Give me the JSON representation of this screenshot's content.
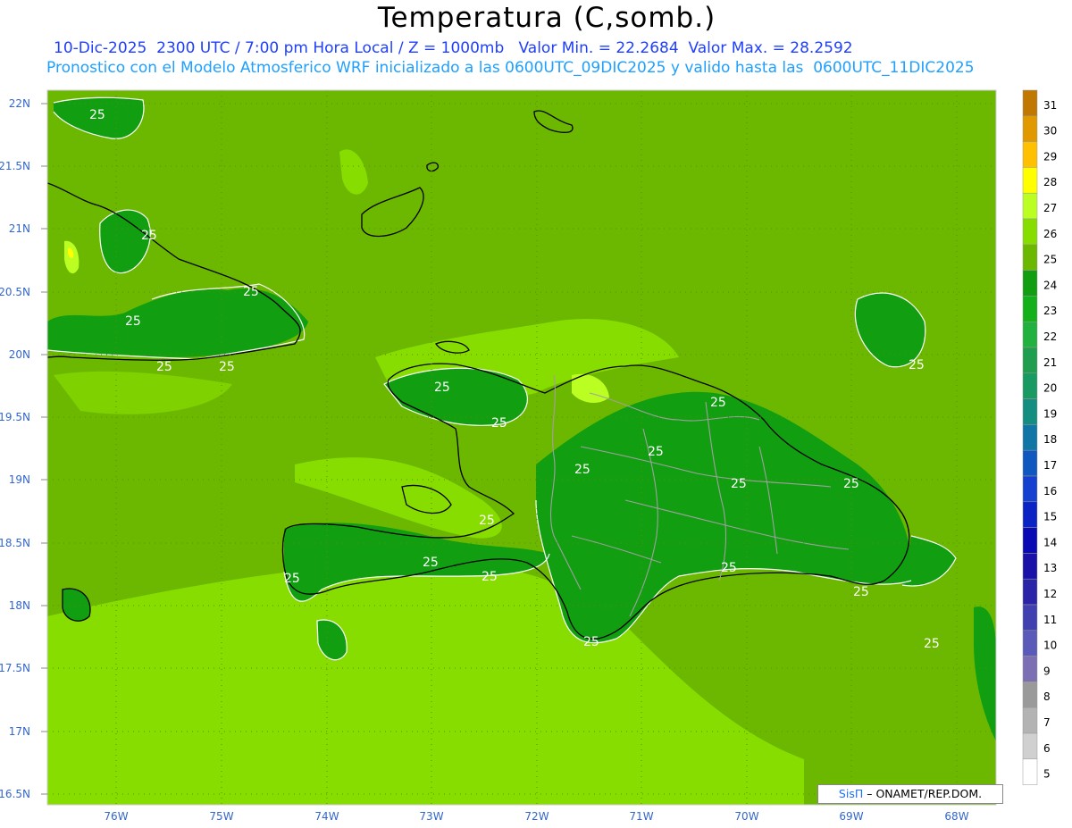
{
  "title": "Temperatura (C,somb.)",
  "subtitle_line1": "10-Dic-2025  2300 UTC / 7:00 pm Hora Local / Z = 1000mb   Valor Min. = 22.2684  Valor Max. = 28.2592",
  "subtitle_line2": "Pronostico con el Modelo Atmosferico WRF inicializado a las 0600UTC_09DIC2025 y valido hasta las  0600UTC_11DIC2025",
  "credit": {
    "sis": "SisΠ",
    "rest": "– ONAMET/REP.DOM."
  },
  "lat_labels": [
    "22N",
    "21.5N",
    "21N",
    "20.5N",
    "20N",
    "19.5N",
    "19N",
    "18.5N",
    "18N",
    "17.5N",
    "17N",
    "16.5N"
  ],
  "lon_labels": [
    "76W",
    "75W",
    "74W",
    "73W",
    "72W",
    "71W",
    "70W",
    "69W",
    "68W"
  ],
  "contour_label": "25",
  "colorbar": {
    "values": [
      31,
      30,
      29,
      28,
      27,
      26,
      25,
      24,
      23,
      22,
      21,
      20,
      19,
      18,
      17,
      16,
      15,
      14,
      13,
      12,
      11,
      10,
      9,
      8,
      7,
      6,
      5
    ],
    "colors": [
      "#c07800",
      "#e09a00",
      "#ffc000",
      "#ffff00",
      "#bbff22",
      "#88dd00",
      "#6cb800",
      "#119e11",
      "#14b01a",
      "#21b13e",
      "#1e9e4e",
      "#189a62",
      "#148e80",
      "#1176a5",
      "#1157c0",
      "#1540d0",
      "#0c23c4",
      "#0a0ab5",
      "#1a12a8",
      "#2a24a8",
      "#4040b0",
      "#5a5ab8",
      "#7d6fb4",
      "#9a9a9a",
      "#b3b3b3",
      "#d0d0d0",
      "#ffffff"
    ]
  },
  "colors": {
    "ocean": "#6cb800",
    "land_warm": "#88dd00",
    "land_cool": "#119e11",
    "contour": "#ffffff",
    "coast": "#000000",
    "border": "#a0a0a0",
    "grid_label": "#3366cc"
  }
}
